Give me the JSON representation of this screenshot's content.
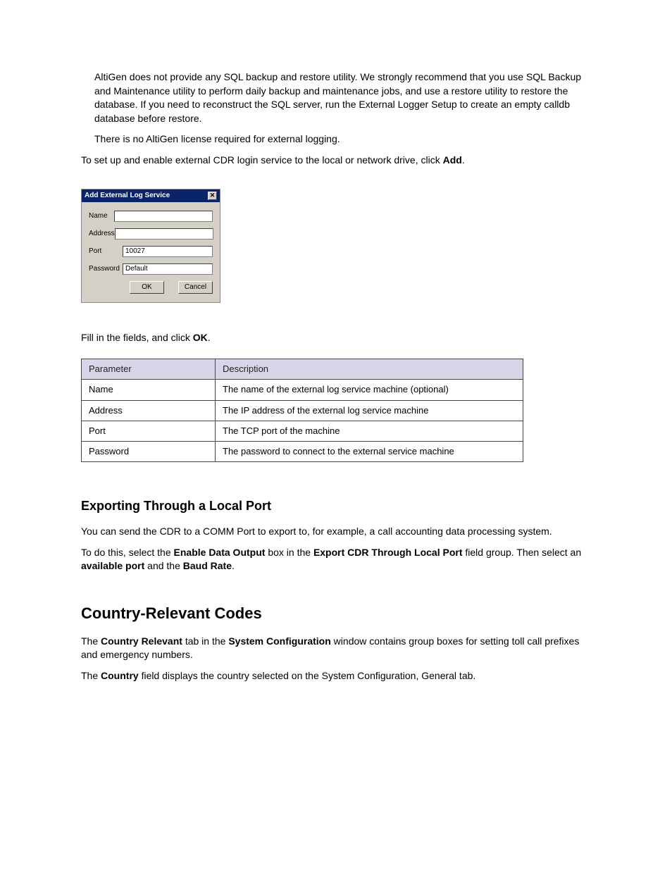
{
  "intro": {
    "p1": "AltiGen does not provide any SQL backup and restore utility. We strongly recommend that you use SQL Backup and Maintenance utility to perform daily backup and maintenance jobs, and use a restore utility to restore the database. If you need to reconstruct the SQL server, run the External Logger Setup to create an empty calldb database before restore.",
    "p2": "There is no AltiGen license required for external logging.",
    "p3a": "To set up and enable external CDR login service to the local or network drive, click ",
    "p3b": "Add",
    "p3c": "."
  },
  "dialog": {
    "title": "Add External Log Service",
    "labels": {
      "name": "Name",
      "address": "Address",
      "port": "Port",
      "password": "Password"
    },
    "values": {
      "name": "",
      "address": "",
      "port": "10027",
      "password": "Default"
    },
    "buttons": {
      "ok": "OK",
      "cancel": "Cancel"
    }
  },
  "afterDialog": {
    "p1a": "Fill in the fields, and click ",
    "p1b": "OK",
    "p1c": "."
  },
  "table": {
    "headers": {
      "col1": "Parameter",
      "col2": "Description"
    },
    "rows": [
      {
        "c1": "Name",
        "c2": "The name of the external log service machine (optional)"
      },
      {
        "c1": "Address",
        "c2": "The IP address of the external log service machine"
      },
      {
        "c1": "Port",
        "c2": "The TCP port of the machine"
      },
      {
        "c1": "Password",
        "c2": "The password to connect to the external service machine"
      }
    ]
  },
  "comm": {
    "heading": "Exporting Through a Local Port",
    "p1": "You can send the CDR to a COMM Port to export to, for example, a call accounting data processing system.",
    "p2_parts": [
      "To do this, select the ",
      "Enable Data Output",
      " box in the ",
      "Export CDR Through Local Port",
      " field group. Then select an ",
      "available port",
      " and the ",
      "Baud Rate",
      "."
    ]
  },
  "countrycodes": {
    "heading": "Country-Relevant Codes",
    "p1_parts": [
      "The ",
      "Country Relevant",
      " tab in the ",
      "System Configuration",
      " window contains group boxes for setting toll call prefixes and emergency numbers."
    ],
    "p2_parts": [
      "The ",
      "Country",
      " field displays the country selected on the System Configuration, General tab."
    ]
  }
}
